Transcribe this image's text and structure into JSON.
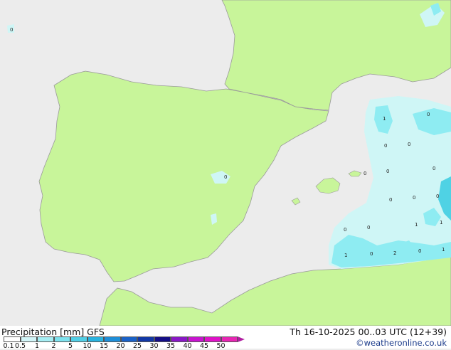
{
  "colors": {
    "sea": "#ececec",
    "land": "#c8f59a",
    "coast": "#9a9a9a",
    "precip_light": "#cff6f6",
    "precip_mid": "#8eecf2",
    "precip_strong": "#4fd2e4"
  },
  "map_labels": [
    "0",
    "1",
    "0",
    "0",
    "0",
    "0",
    "0",
    "0",
    "0",
    "0",
    "0",
    "0",
    "0",
    "1",
    "1",
    "1",
    "0",
    "2",
    "0",
    "1",
    "0"
  ],
  "legend": {
    "title": "Precipitation [mm]  GFS",
    "ticks": [
      "0.1",
      "0.5",
      "1",
      "2",
      "5",
      "10",
      "15",
      "20",
      "25",
      "30",
      "35",
      "40",
      "45",
      "50"
    ],
    "colors": [
      "#ffffff",
      "#d2f5f8",
      "#a6eef4",
      "#7ee2ee",
      "#52cfe6",
      "#2ab4e0",
      "#1e8ed8",
      "#1a62c8",
      "#1238a6",
      "#140e86",
      "#8a18c6",
      "#c814d0",
      "#e012c8",
      "#e826b4"
    ]
  },
  "valid_time": "Th 16-10-2025 00..03 UTC (12+39)",
  "credit": "©weatheronline.co.uk"
}
